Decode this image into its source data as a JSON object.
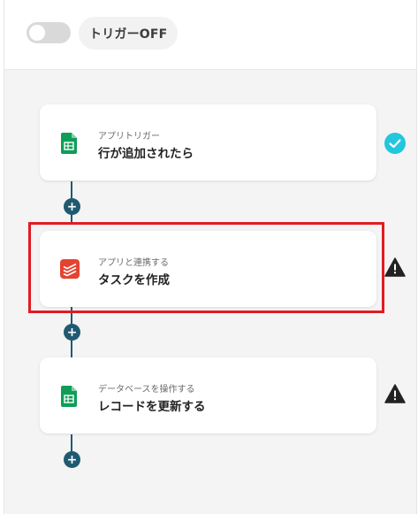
{
  "header": {
    "trigger_toggle_state": "off",
    "trigger_label": "トリガーOFF"
  },
  "steps": [
    {
      "label": "アプリトリガー",
      "title": "行が追加されたら",
      "icon": "google-sheets-icon",
      "status_icon": "check-circle-icon",
      "status_color": "#22c6dd"
    },
    {
      "label": "アプリと連携する",
      "title": "タスクを作成",
      "icon": "todoist-icon",
      "status_icon": "warning-icon",
      "status_color": "#222222"
    },
    {
      "label": "データベースを操作する",
      "title": "レコードを更新する",
      "icon": "google-sheets-icon",
      "status_icon": "warning-icon",
      "status_color": "#222222"
    }
  ],
  "add_step_symbol": "+",
  "colors": {
    "connector": "#1f5a71",
    "highlight": "#e21b23",
    "sheets_green": "#0f9d58",
    "todoist_red": "#e44332"
  }
}
